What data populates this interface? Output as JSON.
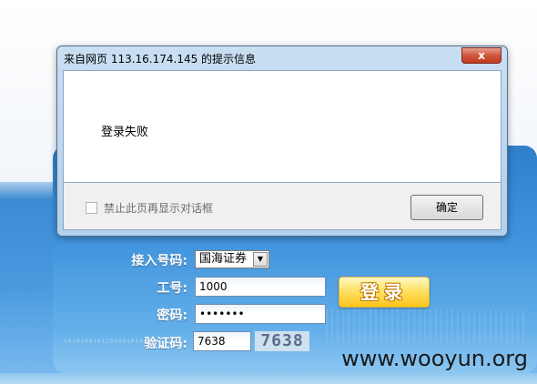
{
  "dialog": {
    "title": "来自网页 113.16.174.145 的提示信息",
    "close_label": "x",
    "message": "登录失败",
    "checkbox_label": "禁止此页再显示对话框",
    "ok_label": "确定"
  },
  "login": {
    "broker_label": "接入号码:",
    "broker_value": "国海证券",
    "employee_label": "工号:",
    "employee_value": "1000",
    "password_label": "密码:",
    "password_value": "•••••••",
    "captcha_label": "验证码:",
    "captcha_input": "7638",
    "captcha_image_text": "7638",
    "login_button": "登录"
  },
  "decor": {
    "binary_strip": "1010100101101001010010110"
  },
  "watermark": "www.wooyun.org"
}
